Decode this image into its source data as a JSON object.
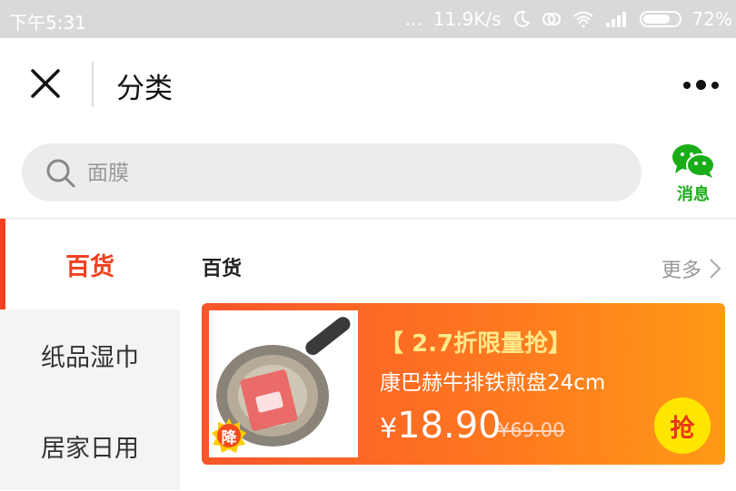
{
  "status_bar": {
    "time": "下午5:31",
    "dots": "...",
    "speed": "11.9K/s",
    "battery": "72%"
  },
  "titlebar": {
    "title": "分类"
  },
  "search": {
    "placeholder": "面膜"
  },
  "messages": {
    "label": "消息",
    "color": "#1aad19"
  },
  "sidebar": {
    "items": [
      {
        "label": "百货",
        "active": true
      },
      {
        "label": "纸品湿巾",
        "active": false
      },
      {
        "label": "居家日用",
        "active": false
      }
    ]
  },
  "section": {
    "title": "百货",
    "more": "更多"
  },
  "product": {
    "tag": "【 2.7折限量抢】",
    "name": "康巴赫牛排铁煎盘24cm",
    "currency": "¥",
    "price": "18.90",
    "original_price": "¥69.00",
    "badge": "降",
    "grab_label": "抢"
  },
  "colors": {
    "accent": "#f2401e",
    "card_gradient_start": "#f7552a",
    "card_gradient_end": "#ff9a16",
    "grab_button": "#ffe600"
  }
}
